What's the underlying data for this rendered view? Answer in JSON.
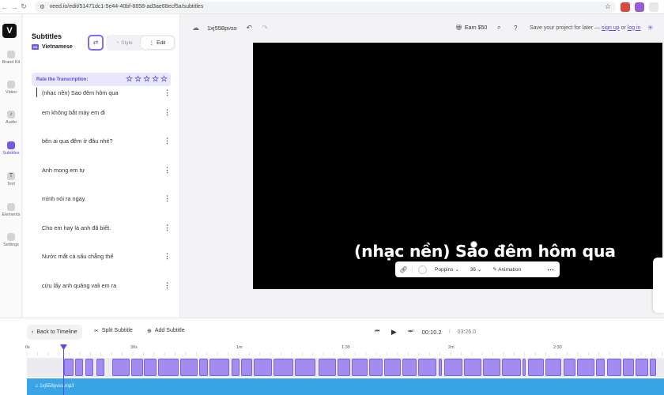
{
  "browser": {
    "url": "veed.io/edit/51471dc1-5e44-40bf-8858-ad3ae68ecf5a/subtitles"
  },
  "rail": {
    "items": [
      {
        "label": "Brand Kit",
        "icon": "brand-kit-icon"
      },
      {
        "label": "Video",
        "icon": "video-icon"
      },
      {
        "label": "Audio",
        "icon": "audio-icon"
      },
      {
        "label": "Subtitles",
        "icon": "subtitles-icon"
      },
      {
        "label": "Text",
        "icon": "text-icon"
      },
      {
        "label": "Elements",
        "icon": "elements-icon"
      },
      {
        "label": "Settings",
        "icon": "settings-icon"
      }
    ]
  },
  "panel": {
    "title": "Subtitles",
    "language": "Vietnamese",
    "style_label": "Style",
    "edit_label": "Edit",
    "rate_label": "Rate the Transcription:",
    "subtitles": [
      "(nhạc nền) Sao đêm hôm qua",
      "em không bắt máy em đi",
      "bên ai qua đêm ở đâu nhé?",
      "Anh mong em tự",
      "mình nói ra ngay.",
      "Cho em hay là anh đã biết.",
      "Nước mắt cá sấu chẳng thể",
      "cứu lấy anh quăng vali em ra"
    ]
  },
  "topbar": {
    "project_name": "1xj558pvss",
    "earn": "Earn $50",
    "save_text": "Save your project for later —",
    "sign_up": "sign up",
    "or": "or",
    "log_in": "log in"
  },
  "preview": {
    "caption": "(nhạc nền) Sao đêm hôm qua",
    "font": "Poppins",
    "size": "36",
    "animation": "Animation"
  },
  "timeline": {
    "back": "Back to Timeline",
    "split": "Split Subtitle",
    "add": "Add Subtitle",
    "current_time": "00:10.2",
    "separator": "/",
    "duration": "03:26.0",
    "ticks": [
      "0s",
      "30s",
      "1m",
      "1:30",
      "2m",
      "2:30"
    ],
    "audio_label": "1xj558pvss.mp3"
  },
  "colors": {
    "accent": "#6d5ce8",
    "clip": "#a38bf2",
    "audio": "#3aa5e6"
  }
}
